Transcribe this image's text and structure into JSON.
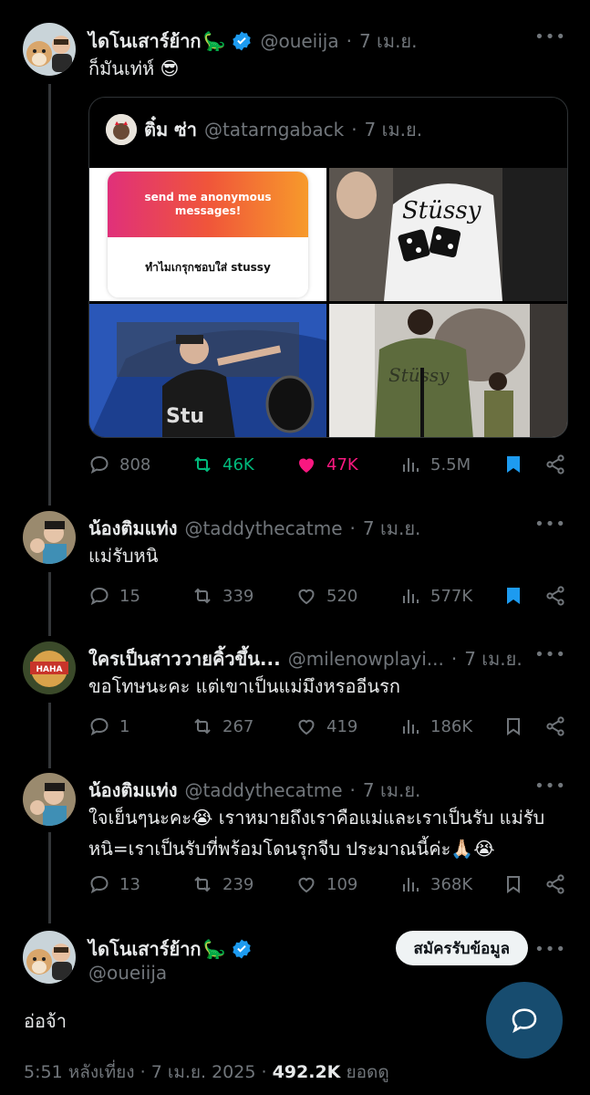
{
  "main_post": {
    "name": "ไดโนเสาร์ย้าก",
    "name_emoji": "🦕",
    "handle": "@oueiija",
    "time": "7 เม.ย.",
    "text": "ก็มันเท่ห์ 😎",
    "quote": {
      "name": "ติ๋ม ซ่า",
      "handle": "@tatarngaback",
      "time": "7 เม.ย.",
      "image1_title": "send me anonymous messages!",
      "image1_body": "ทำไมเกรุกชอบใส่ stussy"
    },
    "stats": {
      "replies": "808",
      "reposts": "46K",
      "likes": "47K",
      "views": "5.5M"
    },
    "colors": {
      "repost": "#00ba7c",
      "like": "#f91880",
      "bookmark": "#1d9bf0"
    }
  },
  "replies": [
    {
      "name": "น้องติมแท่ง",
      "handle": "@taddythecatme",
      "time": "7 เม.ย.",
      "text": "แม่รับหนิ",
      "stats": {
        "replies": "15",
        "reposts": "339",
        "likes": "520",
        "views": "577K"
      },
      "bookmarked": true
    },
    {
      "name": "ใครเป็นสาววายคิ้วขึ้น...",
      "handle": "@milenowplayi...",
      "time": "7 เม.ย.",
      "text": "ขอโทษนะคะ แต่เขาเป็นแม่มึงหรออีนรก",
      "stats": {
        "replies": "1",
        "reposts": "267",
        "likes": "419",
        "views": "186K"
      },
      "bookmarked": false
    },
    {
      "name": "น้องติมแท่ง",
      "handle": "@taddythecatme",
      "time": "7 เม.ย.",
      "text_line1": "ใจเย็นๆนะคะ😭 เราหมายถึงเราคือแม่และเราเป็นรับ แม่รับ",
      "text_line2": "หนิ=เราเป็นรับที่พร้อมโดนรุกจีบ ประมาณนี้ค่ะ🙏🏻😭",
      "stats": {
        "replies": "13",
        "reposts": "239",
        "likes": "109",
        "views": "368K"
      },
      "bookmarked": false
    }
  ],
  "final_post": {
    "name": "ไดโนเสาร์ย้าก",
    "name_emoji": "🦕",
    "handle": "@oueiija",
    "subscribe_label": "สมัครรับข้อมูล",
    "text": "อ่อจ้า",
    "footer_time": "5:51 หลังเที่ยง · 7 เม.ย. 2025 · ",
    "footer_views": "492.2K",
    "footer_views_label": " ยอดดู"
  }
}
